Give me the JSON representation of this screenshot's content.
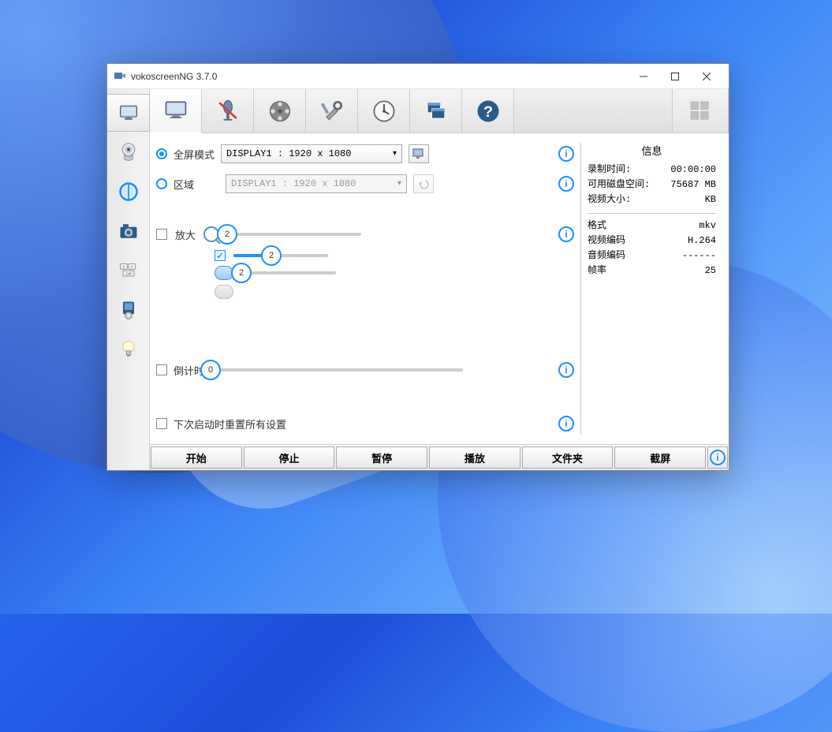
{
  "window": {
    "title": "vokoscreenNG 3.7.0"
  },
  "mode": {
    "fullscreen_label": "全屏模式",
    "area_label": "区域",
    "display_value": "DISPLAY1 :  1920 x 1080",
    "display_value_2": "DISPLAY1 :  1920 x 1080"
  },
  "zoom": {
    "label": "放大",
    "slider1": "2",
    "slider2": "2",
    "slider3": "2"
  },
  "countdown": {
    "label": "倒计时",
    "value": "0"
  },
  "reset": {
    "label": "下次启动时重置所有设置"
  },
  "info": {
    "title": "信息",
    "rec_time_label": "录制时间:",
    "rec_time_value": "00:00:00",
    "disk_label": "可用磁盘空间:",
    "disk_value": "75687 MB",
    "video_size_label": "视频大小:",
    "video_size_value": "KB",
    "format_label": "格式",
    "format_value": "mkv",
    "vcodec_label": "视频编码",
    "vcodec_value": "H.264",
    "acodec_label": "音频编码",
    "acodec_value": "------",
    "fps_label": "帧率",
    "fps_value": "25"
  },
  "buttons": {
    "start": "开始",
    "stop": "停止",
    "pause": "暂停",
    "play": "播放",
    "folder": "文件夹",
    "screenshot": "截屏"
  }
}
